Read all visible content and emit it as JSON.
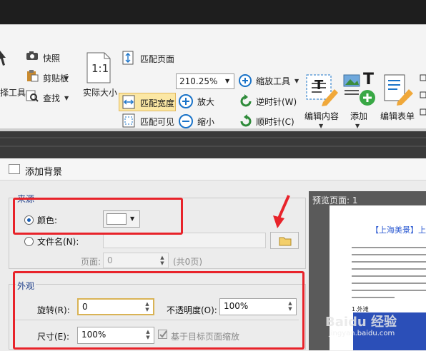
{
  "ribbon": {
    "tool_left_label": "择工具",
    "snapshot": "快照",
    "clipboard": "剪贴板",
    "find": "查找",
    "actual_size": "实际大小",
    "actual_size_glyph": "1:1",
    "fit_page": "匹配页面",
    "fit_width": "匹配宽度",
    "fit_visible": "匹配可见",
    "zoom_value": "210.25%",
    "zoom_tool": "缩放工具",
    "zoom_in": "放大",
    "zoom_out": "缩小",
    "rotate_ccw": "逆时针(W)",
    "rotate_cw": "顺时针(C)",
    "edit_content": "编辑内容",
    "add": "添加",
    "edit_form": "编辑表单",
    "add_glyph": "T",
    "edit_glyph": "T"
  },
  "dialog": {
    "title": "添加背景",
    "source_group": "来源",
    "color_label": "颜色:",
    "color_value": "#ffffff",
    "filename_label": "文件名(N):",
    "filename_value": "",
    "page_label": "页面:",
    "page_value": "0",
    "page_total": "(共0页)",
    "appearance_group": "外观",
    "rotation_label": "旋转(R):",
    "rotation_value": "0",
    "opacity_label": "不透明度(O):",
    "opacity_value": "100%",
    "size_label": "尺寸(E):",
    "size_value": "100%",
    "scale_checkbox_label": "基于目标页面缩放",
    "scale_checked": true
  },
  "preview": {
    "label": "预览页面: 1",
    "doc_title": "【上海美景】上",
    "doc_heading": "1.外滩"
  },
  "watermark": {
    "main": "Baidu 经验",
    "sub": "jingyan.baidu.com"
  },
  "colors": {
    "annotation_red": "#e8232a",
    "accent_blue": "#1a5fb4"
  }
}
